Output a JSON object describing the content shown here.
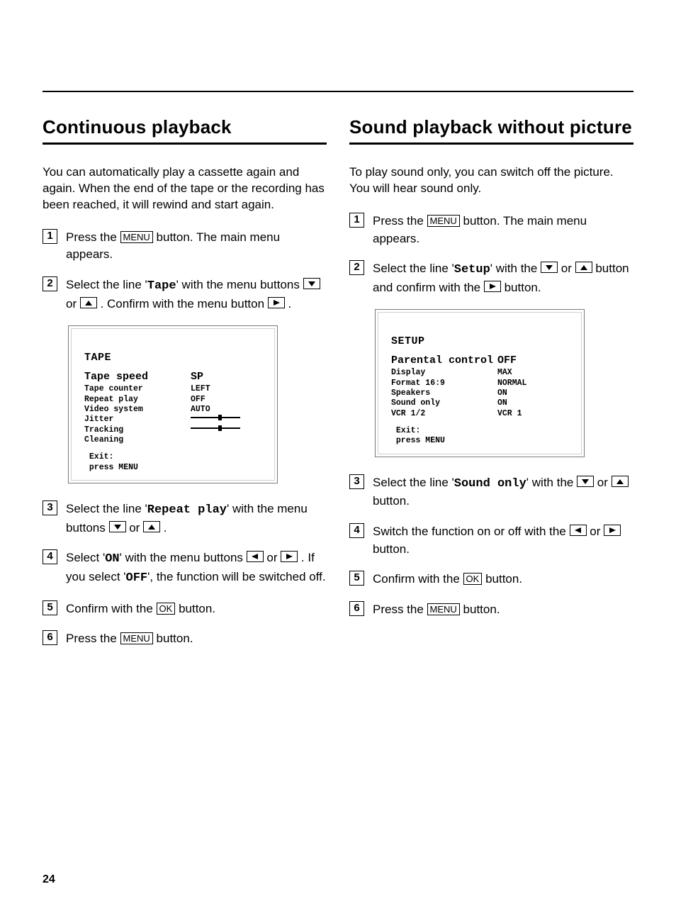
{
  "pageNumber": "24",
  "left": {
    "heading": "Continuous playback",
    "intro": "You can automatically play a cassette again and again. When the end of the tape or the recording has been reached, it will rewind and start again.",
    "steps": {
      "s1_a": "Press the ",
      "s1_menu": "MENU",
      "s1_b": " button. The main menu appears.",
      "s2_a": "Select the line '",
      "s2_tape": "Tape",
      "s2_b": "' with the menu buttons ",
      "s2_or": " or ",
      "s2_c": " . Confirm with the menu button ",
      "s2_d": " .",
      "s3_a": "Select the line '",
      "s3_rp": "Repeat play",
      "s3_b": "' with the menu buttons ",
      "s3_or": " or ",
      "s3_c": " .",
      "s4_a": "Select '",
      "s4_on": "ON",
      "s4_b": "' with the menu buttons ",
      "s4_or": " or ",
      "s4_c": " . If you select '",
      "s4_off": "OFF",
      "s4_d": "', the function will be switched off.",
      "s5_a": "Confirm with the ",
      "s5_ok": "OK",
      "s5_b": " button.",
      "s6_a": "Press the ",
      "s6_menu": "MENU",
      "s6_b": " button."
    },
    "screen": {
      "title": "TAPE",
      "big": {
        "k": "Tape speed",
        "v": "SP"
      },
      "rows": [
        {
          "k": "Tape counter",
          "v": "LEFT"
        },
        {
          "k": "Repeat play",
          "v": "OFF"
        },
        {
          "k": "Video system",
          "v": "AUTO"
        },
        {
          "k": "Jitter",
          "v": "slider"
        },
        {
          "k": "Tracking",
          "v": "slider"
        },
        {
          "k": "Cleaning",
          "v": ""
        }
      ],
      "exit1": " Exit:",
      "exit2": " press MENU"
    }
  },
  "right": {
    "heading": "Sound playback without picture",
    "intro": "To play sound only, you can switch off the picture. You will hear sound only.",
    "steps": {
      "s1_a": "Press the ",
      "s1_menu": "MENU",
      "s1_b": " button. The main menu appears.",
      "s2_a": "Select the line '",
      "s2_setup": "Setup",
      "s2_b": "' with the ",
      "s2_or": " or ",
      "s2_c": " button and confirm with the ",
      "s2_d": " button.",
      "s3_a": "Select the line '",
      "s3_so": "Sound only",
      "s3_b": "' with the ",
      "s3_or": " or ",
      "s3_c": " button.",
      "s4_a": "Switch the function on or off with the ",
      "s4_or": " or ",
      "s4_b": " button.",
      "s5_a": "Confirm with the ",
      "s5_ok": "OK",
      "s5_b": " button.",
      "s6_a": "Press the ",
      "s6_menu": "MENU",
      "s6_b": " button."
    },
    "screen": {
      "title": "SETUP",
      "big": {
        "k": "Parental control",
        "v": "OFF"
      },
      "rows": [
        {
          "k": "Display",
          "v": "MAX"
        },
        {
          "k": "Format 16:9",
          "v": "NORMAL"
        },
        {
          "k": "Speakers",
          "v": "ON"
        },
        {
          "k": "Sound only",
          "v": "ON"
        },
        {
          "k": "VCR 1/2",
          "v": "VCR 1"
        }
      ],
      "exit1": " Exit:",
      "exit2": " press MENU"
    }
  },
  "nums": [
    "1",
    "2",
    "3",
    "4",
    "5",
    "6"
  ]
}
